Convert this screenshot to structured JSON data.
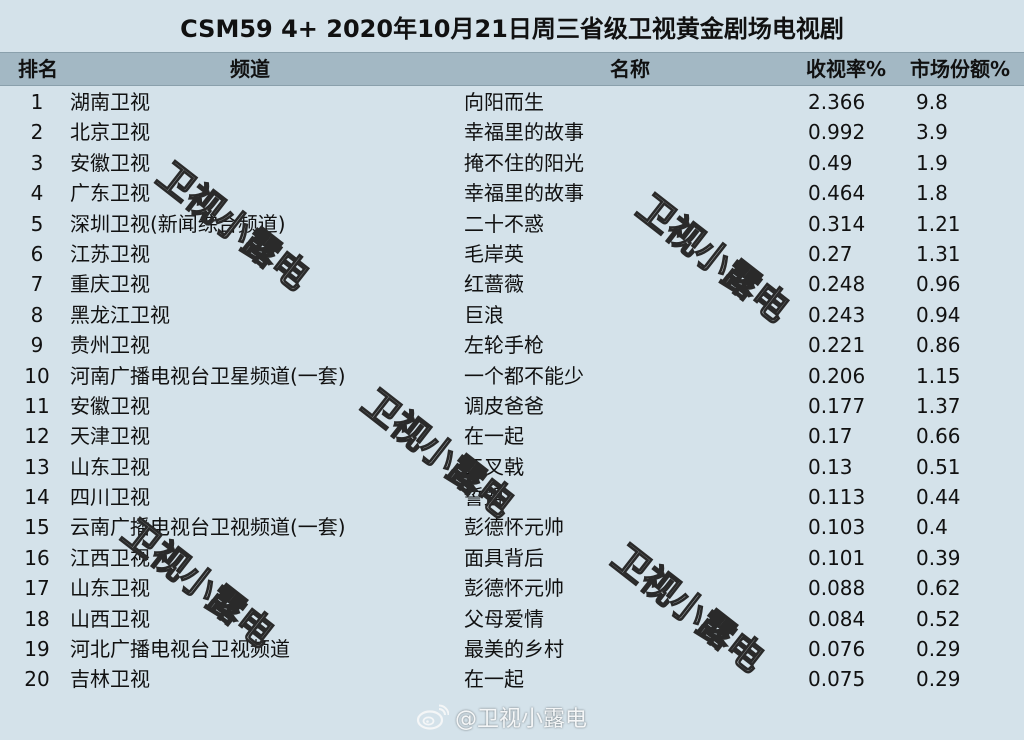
{
  "title": "CSM59 4+ 2020年10月21日周三省级卫视黄金剧场电视剧",
  "headers": {
    "rank": "排名",
    "channel": "频道",
    "name": "名称",
    "rating": "收视率%",
    "share": "市场份额%"
  },
  "rows": [
    {
      "rank": "1",
      "channel": "湖南卫视",
      "name": "向阳而生",
      "rating": "2.366",
      "share": "9.8"
    },
    {
      "rank": "2",
      "channel": "北京卫视",
      "name": "幸福里的故事",
      "rating": "0.992",
      "share": "3.9"
    },
    {
      "rank": "3",
      "channel": "安徽卫视",
      "name": "掩不住的阳光",
      "rating": "0.49",
      "share": "1.9"
    },
    {
      "rank": "4",
      "channel": "广东卫视",
      "name": "幸福里的故事",
      "rating": "0.464",
      "share": "1.8"
    },
    {
      "rank": "5",
      "channel": "深圳卫视(新闻综合频道)",
      "name": "二十不惑",
      "rating": "0.314",
      "share": "1.21"
    },
    {
      "rank": "6",
      "channel": "江苏卫视",
      "name": "毛岸英",
      "rating": "0.27",
      "share": "1.31"
    },
    {
      "rank": "7",
      "channel": "重庆卫视",
      "name": "红蔷薇",
      "rating": "0.248",
      "share": "0.96"
    },
    {
      "rank": "8",
      "channel": "黑龙江卫视",
      "name": "巨浪",
      "rating": "0.243",
      "share": "0.94"
    },
    {
      "rank": "9",
      "channel": "贵州卫视",
      "name": "左轮手枪",
      "rating": "0.221",
      "share": "0.86"
    },
    {
      "rank": "10",
      "channel": "河南广播电视台卫星频道(一套)",
      "name": "一个都不能少",
      "rating": "0.206",
      "share": "1.15"
    },
    {
      "rank": "11",
      "channel": "安徽卫视",
      "name": "调皮爸爸",
      "rating": "0.177",
      "share": "1.37"
    },
    {
      "rank": "12",
      "channel": "天津卫视",
      "name": "在一起",
      "rating": "0.17",
      "share": "0.66"
    },
    {
      "rank": "13",
      "channel": "山东卫视",
      "name": "三叉戟",
      "rating": "0.13",
      "share": "0.51"
    },
    {
      "rank": "14",
      "channel": "四川卫视",
      "name": "誓盟",
      "rating": "0.113",
      "share": "0.44"
    },
    {
      "rank": "15",
      "channel": "云南广播电视台卫视频道(一套)",
      "name": "彭德怀元帅",
      "rating": "0.103",
      "share": "0.4"
    },
    {
      "rank": "16",
      "channel": "江西卫视",
      "name": "面具背后",
      "rating": "0.101",
      "share": "0.39"
    },
    {
      "rank": "17",
      "channel": "山东卫视",
      "name": "彭德怀元帅",
      "rating": "0.088",
      "share": "0.62"
    },
    {
      "rank": "18",
      "channel": "山西卫视",
      "name": "父母爱情",
      "rating": "0.084",
      "share": "0.52"
    },
    {
      "rank": "19",
      "channel": "河北广播电视台卫视频道",
      "name": "最美的乡村",
      "rating": "0.076",
      "share": "0.29"
    },
    {
      "rank": "20",
      "channel": "吉林卫视",
      "name": "在一起",
      "rating": "0.075",
      "share": "0.29"
    }
  ],
  "watermark": "卫视小露电",
  "credit": "@卫视小露电",
  "icons": {
    "credit": "weibo-icon"
  },
  "colors": {
    "background": "#d4e2ea",
    "header": "#a3b8c4",
    "text": "#111111"
  }
}
